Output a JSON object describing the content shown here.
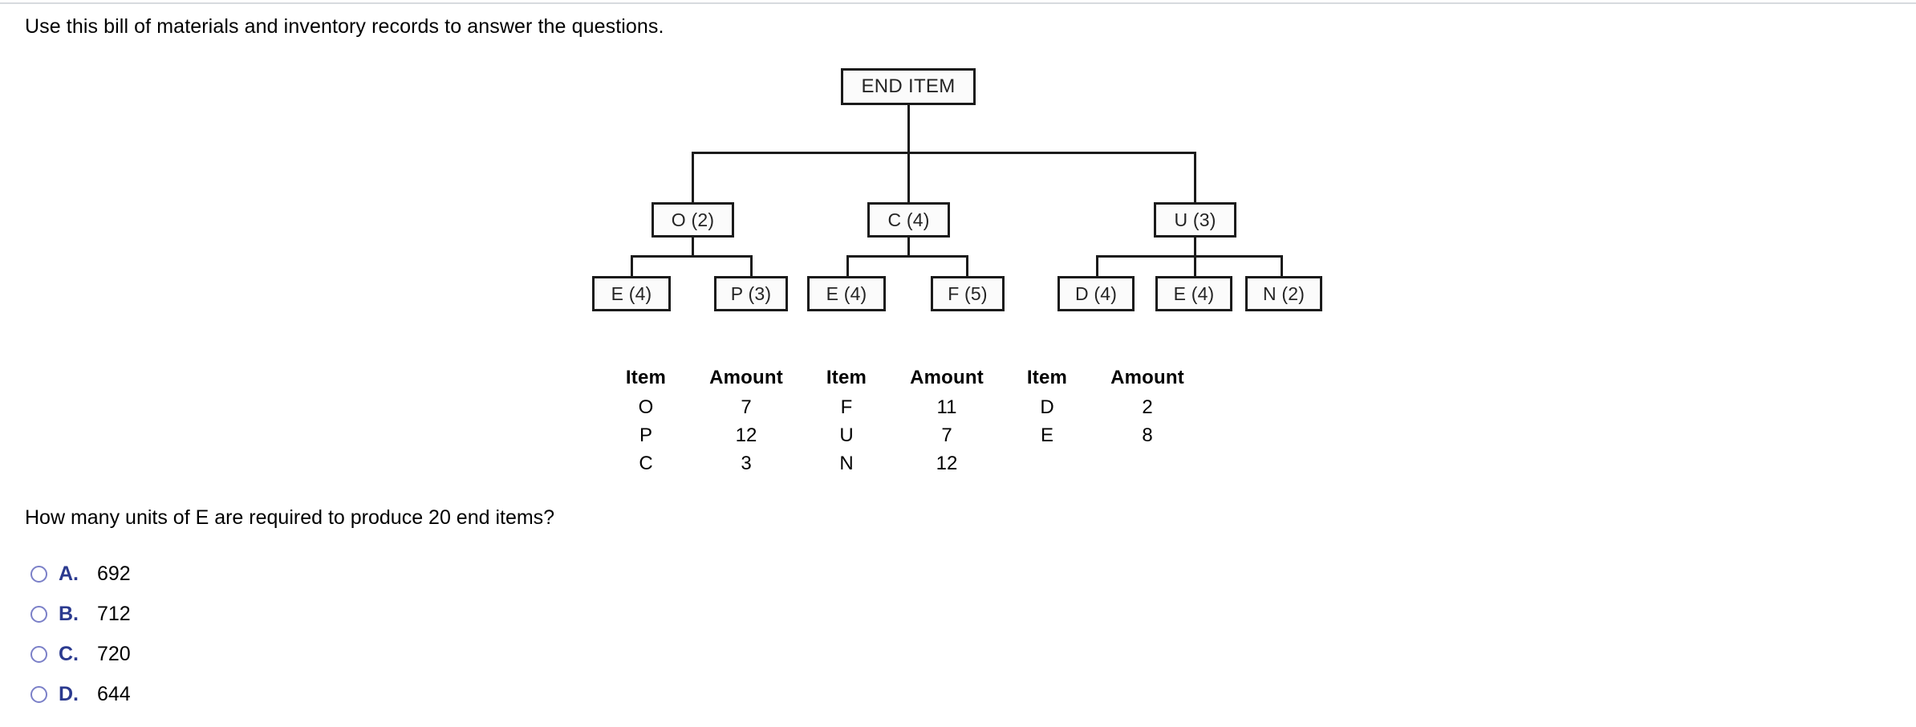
{
  "prompt": "Use this bill of materials and inventory records to answer the questions.",
  "bom": {
    "root": {
      "label": "END ITEM"
    },
    "level1": [
      {
        "label": "O (2)"
      },
      {
        "label": "C (4)"
      },
      {
        "label": "U (3)"
      }
    ],
    "level2": [
      {
        "label": "E (4)"
      },
      {
        "label": "P (3)"
      },
      {
        "label": "E (4)"
      },
      {
        "label": "F (5)"
      },
      {
        "label": "D (4)"
      },
      {
        "label": "E (4)"
      },
      {
        "label": "N (2)"
      }
    ]
  },
  "inventory": {
    "headers": [
      "Item",
      "Amount",
      "Item",
      "Amount",
      "Item",
      "Amount"
    ],
    "rows": [
      [
        "O",
        "7",
        "F",
        "11",
        "D",
        "2"
      ],
      [
        "P",
        "12",
        "U",
        "7",
        "E",
        "8"
      ],
      [
        "C",
        "3",
        "N",
        "12",
        "",
        ""
      ]
    ]
  },
  "question": "How many units of E are required to produce 20 end items?",
  "options": [
    {
      "letter": "A.",
      "text": "692"
    },
    {
      "letter": "B.",
      "text": "712"
    },
    {
      "letter": "C.",
      "text": "720"
    },
    {
      "letter": "D.",
      "text": "644"
    }
  ],
  "colors": {
    "option_letter": "#2b3a8f",
    "radio_border": "#7b80c8",
    "node_border": "#1b1b1b",
    "top_rule": "#d7dade"
  }
}
